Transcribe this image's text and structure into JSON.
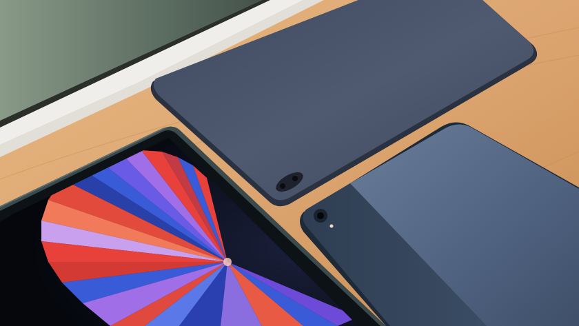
{
  "image": {
    "subjects": [
      "tablet-front-colorful-wallpaper",
      "tablet-back-single-camera-bar",
      "tablet-back-round-camera"
    ],
    "surface": "wooden-table",
    "background": "window-with-blurred-greenery"
  },
  "colors": {
    "wood_light": "#e8b982",
    "wood_dark": "#c98d52",
    "window_frame": "#f2f0ec",
    "window_glass": "#6e7e70",
    "tablet_back_1": "#4b566c",
    "tablet_back_2_dark": "#35455b",
    "tablet_back_2_light": "#566a87",
    "screen_bezel": "#0c1215",
    "wallpaper_red": "#e8403a",
    "wallpaper_blue": "#3a5bd8",
    "wallpaper_purple": "#a06ee6"
  }
}
